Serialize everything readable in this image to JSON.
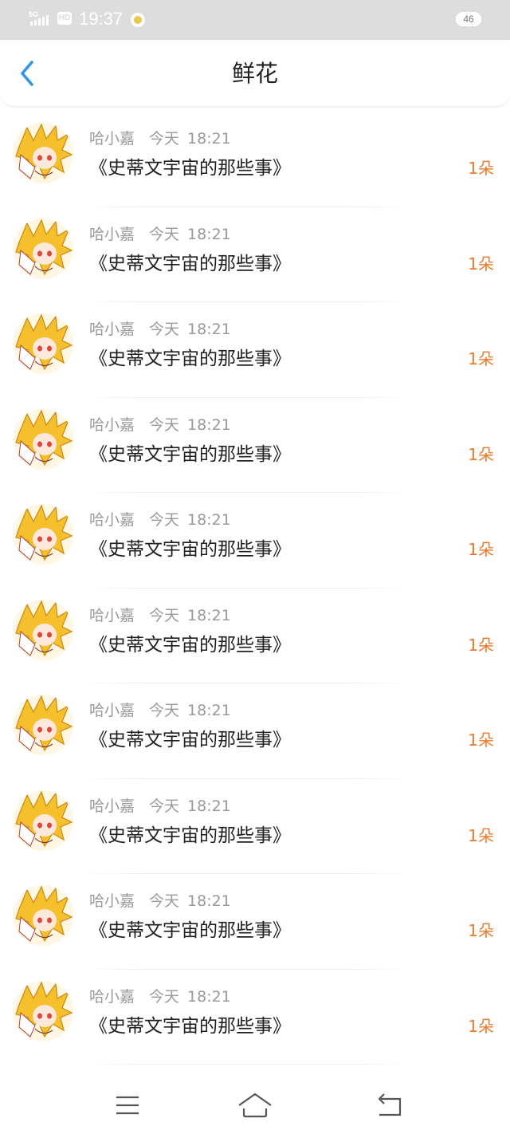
{
  "status_bar": {
    "network": "5G",
    "hd": "HD",
    "time": "19:37",
    "battery": "46"
  },
  "header": {
    "title": "鲜花",
    "back_icon": "chevron-left-icon",
    "accent_color": "#2f95e8"
  },
  "items": [
    {
      "user": "哈小嘉",
      "date": "今天",
      "time": "18:21",
      "title": "《史蒂文宇宙的那些事》",
      "count": "1朵"
    },
    {
      "user": "哈小嘉",
      "date": "今天",
      "time": "18:21",
      "title": "《史蒂文宇宙的那些事》",
      "count": "1朵"
    },
    {
      "user": "哈小嘉",
      "date": "今天",
      "time": "18:21",
      "title": "《史蒂文宇宙的那些事》",
      "count": "1朵"
    },
    {
      "user": "哈小嘉",
      "date": "今天",
      "time": "18:21",
      "title": "《史蒂文宇宙的那些事》",
      "count": "1朵"
    },
    {
      "user": "哈小嘉",
      "date": "今天",
      "time": "18:21",
      "title": "《史蒂文宇宙的那些事》",
      "count": "1朵"
    },
    {
      "user": "哈小嘉",
      "date": "今天",
      "time": "18:21",
      "title": "《史蒂文宇宙的那些事》",
      "count": "1朵"
    },
    {
      "user": "哈小嘉",
      "date": "今天",
      "time": "18:21",
      "title": "《史蒂文宇宙的那些事》",
      "count": "1朵"
    },
    {
      "user": "哈小嘉",
      "date": "今天",
      "time": "18:21",
      "title": "《史蒂文宇宙的那些事》",
      "count": "1朵"
    },
    {
      "user": "哈小嘉",
      "date": "今天",
      "time": "18:21",
      "title": "《史蒂文宇宙的那些事》",
      "count": "1朵"
    },
    {
      "user": "哈小嘉",
      "date": "今天",
      "time": "18:21",
      "title": "《史蒂文宇宙的那些事》",
      "count": "1朵"
    }
  ],
  "nav_bar": {
    "buttons": [
      "menu-icon",
      "home-icon",
      "back-icon"
    ]
  },
  "colors": {
    "count": "#f07a2a",
    "meta": "#9a9a9a",
    "status_bar_bg": "#dddddd"
  }
}
